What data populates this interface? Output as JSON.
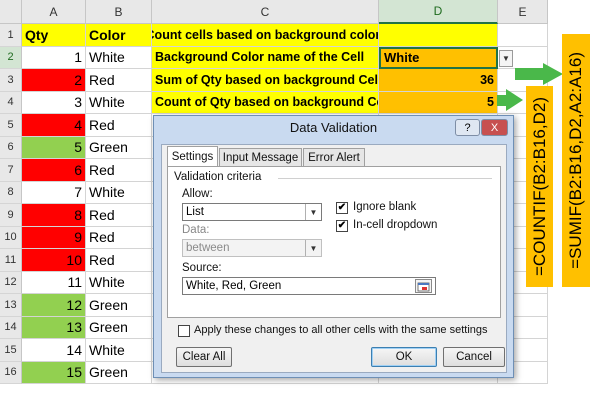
{
  "columns": [
    "A",
    "B",
    "C",
    "D",
    "E"
  ],
  "selected_column": "D",
  "selected_row": "2",
  "rows": [
    {
      "num": "1",
      "a": "Qty",
      "b": "Color",
      "c": "Sum or Count cells based on background color in Excel",
      "d": "",
      "a_bg": "yellow",
      "b_bg": "yellow"
    },
    {
      "num": "2",
      "a": "1",
      "b": "White",
      "c": "Background Color  name of the Cell",
      "d": "White",
      "a_bg": "white"
    },
    {
      "num": "3",
      "a": "2",
      "b": "Red",
      "c": "Sum of Qty based on background Cell Color",
      "d": "36",
      "a_bg": "red"
    },
    {
      "num": "4",
      "a": "3",
      "b": "White",
      "c": "Count of Qty based on background Cell Color",
      "d": "5",
      "a_bg": "white"
    },
    {
      "num": "5",
      "a": "4",
      "b": "Red",
      "a_bg": "red"
    },
    {
      "num": "6",
      "a": "5",
      "b": "Green",
      "a_bg": "green"
    },
    {
      "num": "7",
      "a": "6",
      "b": "Red",
      "a_bg": "red"
    },
    {
      "num": "8",
      "a": "7",
      "b": "White",
      "a_bg": "white"
    },
    {
      "num": "9",
      "a": "8",
      "b": "Red",
      "a_bg": "red"
    },
    {
      "num": "10",
      "a": "9",
      "b": "Red",
      "a_bg": "red"
    },
    {
      "num": "11",
      "a": "10",
      "b": "Red",
      "a_bg": "red"
    },
    {
      "num": "12",
      "a": "11",
      "b": "White",
      "a_bg": "white"
    },
    {
      "num": "13",
      "a": "12",
      "b": "Green",
      "a_bg": "green"
    },
    {
      "num": "14",
      "a": "13",
      "b": "Green",
      "a_bg": "green"
    },
    {
      "num": "15",
      "a": "14",
      "b": "White",
      "a_bg": "white"
    },
    {
      "num": "16",
      "a": "15",
      "b": "Green",
      "a_bg": "green"
    }
  ],
  "colors": {
    "red": "#ff0000",
    "green": "#92d050",
    "white": "#ffffff",
    "yellow": "#ffff00",
    "orange": "#ffc000",
    "arrow": "#4ab84a"
  },
  "formulas": {
    "count": "=COUNTIF(B2:B16,D2)",
    "sum": "=SUMIF(B2:B16,D2,A2:A16)"
  },
  "dialog": {
    "title": "Data Validation",
    "help_glyph": "?",
    "close_glyph": "X",
    "tabs": [
      "Settings",
      "Input Message",
      "Error Alert"
    ],
    "active_tab": "Settings",
    "section_title": "Validation criteria",
    "allow_label": "Allow:",
    "allow_value": "List",
    "data_label": "Data:",
    "data_value": "between",
    "ignore_blank_label": "Ignore blank",
    "ignore_blank_checked": true,
    "in_cell_dropdown_label": "In-cell dropdown",
    "in_cell_dropdown_checked": true,
    "source_label": "Source:",
    "source_value": "White, Red, Green",
    "apply_label": "Apply these changes to all other cells with the same settings",
    "apply_checked": false,
    "clear_all_label": "Clear All",
    "ok_label": "OK",
    "cancel_label": "Cancel"
  }
}
